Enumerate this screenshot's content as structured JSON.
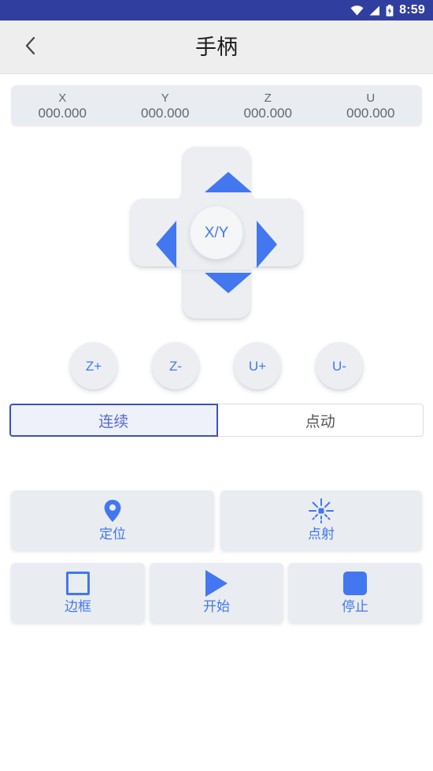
{
  "statusbar": {
    "time": "8:59",
    "icons": [
      "wifi-icon",
      "signal-icon",
      "battery-charging-icon"
    ]
  },
  "titlebar": {
    "back_icon": "chevron-left-icon",
    "title": "手柄"
  },
  "coordinates": [
    {
      "axis": "X",
      "value": "000.000"
    },
    {
      "axis": "Y",
      "value": "000.000"
    },
    {
      "axis": "Z",
      "value": "000.000"
    },
    {
      "axis": "U",
      "value": "000.000"
    }
  ],
  "dpad": {
    "center_label": "X/Y",
    "up_icon": "arrow-up-icon",
    "down_icon": "arrow-down-icon",
    "left_icon": "arrow-left-icon",
    "right_icon": "arrow-right-icon"
  },
  "axis_buttons": [
    {
      "label": "Z+"
    },
    {
      "label": "Z-"
    },
    {
      "label": "U+"
    },
    {
      "label": "U-"
    }
  ],
  "mode_toggle": {
    "options": [
      {
        "label": "连续",
        "selected": true
      },
      {
        "label": "点动",
        "selected": false
      }
    ]
  },
  "actions_primary": [
    {
      "label": "定位",
      "icon": "location-pin-icon"
    },
    {
      "label": "点射",
      "icon": "laser-burst-icon"
    }
  ],
  "actions_secondary": [
    {
      "label": "边框",
      "icon": "square-outline-icon"
    },
    {
      "label": "开始",
      "icon": "play-icon"
    },
    {
      "label": "停止",
      "icon": "stop-square-icon"
    }
  ],
  "colors": {
    "status_bar": "#303f9f",
    "accent_blue": "#4277f0",
    "selected_border": "#3f51b5",
    "selected_fill": "#eef0fa",
    "button_fill": "#e9edf1",
    "page_bg": "#ffffff"
  }
}
